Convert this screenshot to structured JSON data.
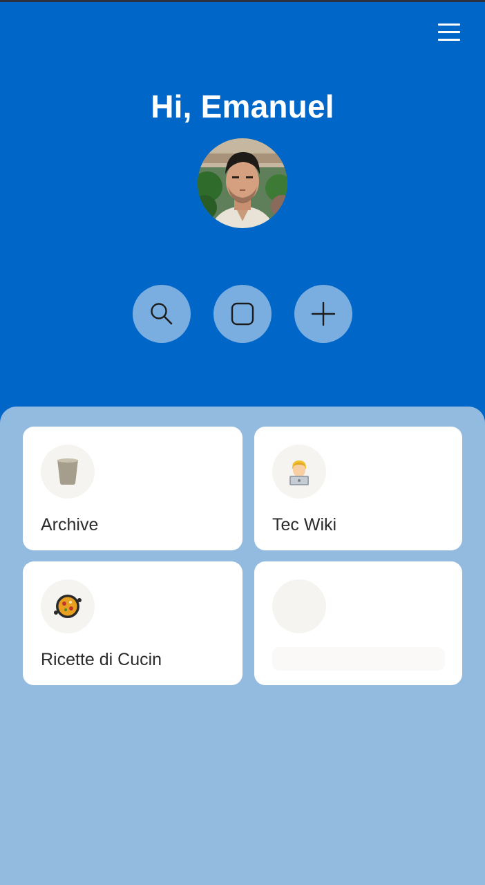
{
  "header": {
    "greeting": "Hi, Emanuel",
    "menu_icon": "hamburger-menu-icon",
    "background_color": "#0066c8"
  },
  "avatar": {
    "description_icon": "user-profile-photo"
  },
  "actions": [
    {
      "name": "search",
      "icon": "search-icon"
    },
    {
      "name": "square",
      "icon": "square-icon"
    },
    {
      "name": "add",
      "icon": "plus-icon"
    }
  ],
  "panel": {
    "background_color": "#93bbe0"
  },
  "cards": [
    {
      "label": "Archive",
      "icon": "cup-icon"
    },
    {
      "label": "Tec Wiki",
      "icon": "technologist-emoji-icon"
    },
    {
      "label": "Ricette di Cucin",
      "icon": "paella-emoji-icon"
    },
    {
      "label": "",
      "icon": "placeholder-icon"
    }
  ]
}
